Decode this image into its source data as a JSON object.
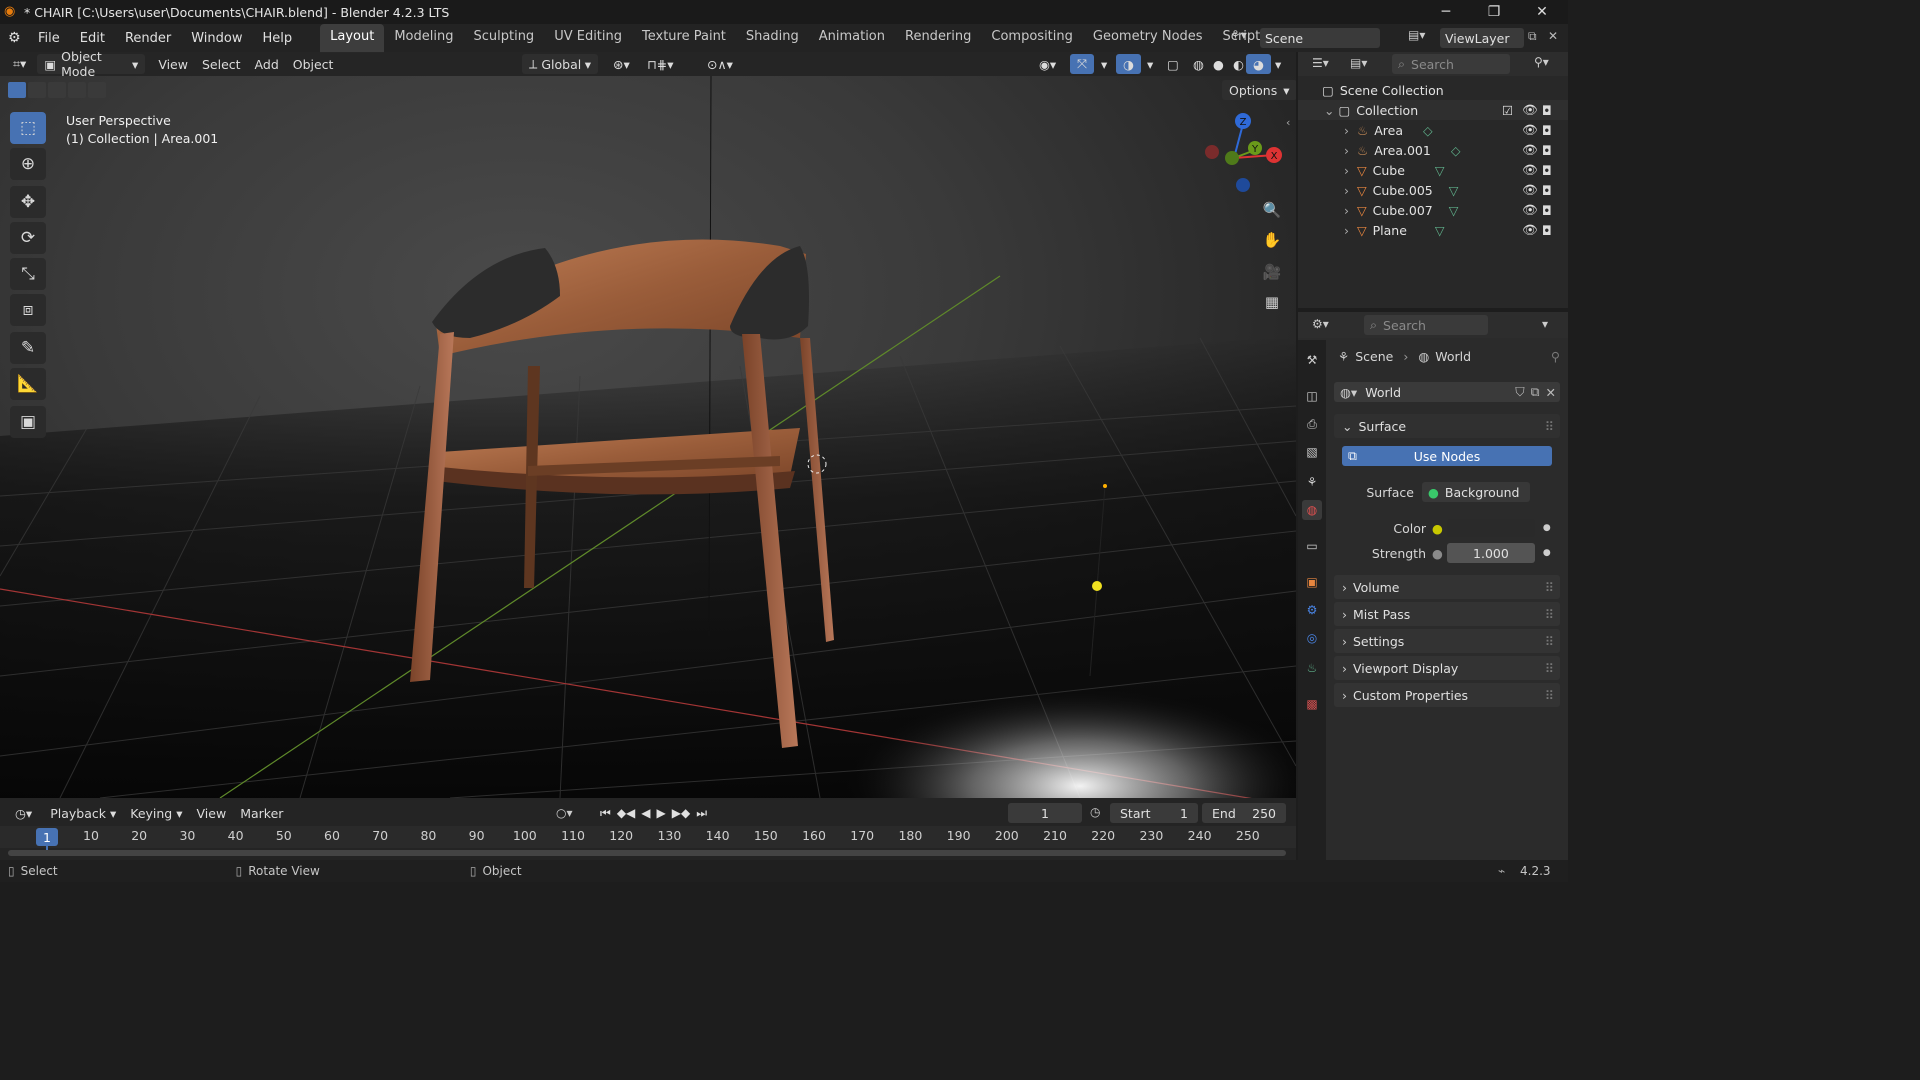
{
  "window": {
    "title": "* CHAIR [C:\\Users\\user\\Documents\\CHAIR.blend] - Blender 4.2.3 LTS",
    "minimize": "─",
    "maximize": "❐",
    "close": "✕"
  },
  "menu": {
    "file": "File",
    "edit": "Edit",
    "render": "Render",
    "window": "Window",
    "help": "Help"
  },
  "workspaces": [
    "Layout",
    "Modeling",
    "Sculpting",
    "UV Editing",
    "Texture Paint",
    "Shading",
    "Animation",
    "Rendering",
    "Compositing",
    "Geometry Nodes",
    "Scripting"
  ],
  "scene": {
    "label": "Scene",
    "viewlayer": "ViewLayer"
  },
  "viewport_header": {
    "mode": "Object Mode",
    "view": "View",
    "select": "Select",
    "add": "Add",
    "object": "Object",
    "orientation": "Global",
    "options": "Options"
  },
  "viewport": {
    "perspective": "User Perspective",
    "collection": "(1) Collection | Area.001",
    "gizmo": {
      "z": "Z",
      "y": "Y",
      "x": "X"
    }
  },
  "outliner": {
    "search_placeholder": "Search",
    "scene_collection": "Scene Collection",
    "collection": "Collection",
    "items": [
      "Area",
      "Area.001",
      "Cube",
      "Cube.005",
      "Cube.007",
      "Plane"
    ]
  },
  "properties": {
    "search_placeholder": "Search",
    "breadcrumb_scene": "Scene",
    "breadcrumb_world": "World",
    "world_name": "World",
    "surface_panel": "Surface",
    "use_nodes": "Use Nodes",
    "surface_label": "Surface",
    "surface_value": "Background",
    "color_label": "Color",
    "strength_label": "Strength",
    "strength_value": "1.000",
    "panels": [
      "Volume",
      "Mist Pass",
      "Settings",
      "Viewport Display",
      "Custom Properties"
    ]
  },
  "timeline": {
    "playback": "Playback",
    "keying": "Keying",
    "view": "View",
    "marker": "Marker",
    "current_frame": "1",
    "start_label": "Start",
    "start_value": "1",
    "end_label": "End",
    "end_value": "250",
    "frame_marker": "1",
    "ruler": [
      "10",
      "20",
      "30",
      "40",
      "50",
      "60",
      "70",
      "80",
      "90",
      "100",
      "110",
      "120",
      "130",
      "140",
      "150",
      "160",
      "170",
      "180",
      "190",
      "200",
      "210",
      "220",
      "230",
      "240",
      "250"
    ]
  },
  "statusbar": {
    "select": "Select",
    "rotate": "Rotate View",
    "object": "Object",
    "version": "4.2.3"
  },
  "colors": {
    "accent": "#4772b3",
    "active_tab": "#3d3d3d",
    "mesh_icon": "#e8863f",
    "light_icon": "#c58a56"
  }
}
